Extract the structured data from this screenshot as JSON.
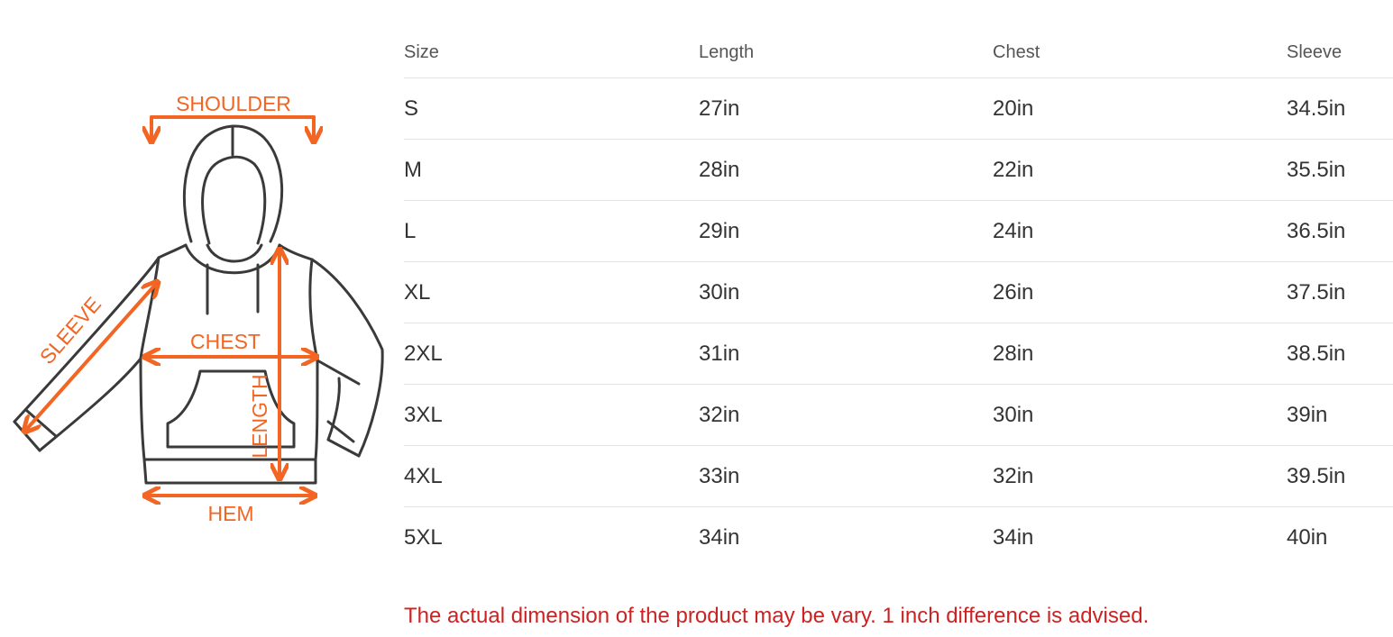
{
  "diagram": {
    "labels": {
      "shoulder": "SHOULDER",
      "sleeve": "SLEEVE",
      "chest": "CHEST",
      "length": "LENGTH",
      "hem": "HEM"
    },
    "accent_color": "#f26522",
    "outline_color": "#3a3a3a"
  },
  "table": {
    "headers": [
      "Size",
      "Length",
      "Chest",
      "Sleeve"
    ],
    "rows": [
      [
        "S",
        "27in",
        "20in",
        "34.5in"
      ],
      [
        "M",
        "28in",
        "22in",
        "35.5in"
      ],
      [
        "L",
        "29in",
        "24in",
        "36.5in"
      ],
      [
        "XL",
        "30in",
        "26in",
        "37.5in"
      ],
      [
        "2XL",
        "31in",
        "28in",
        "38.5in"
      ],
      [
        "3XL",
        "32in",
        "30in",
        "39in"
      ],
      [
        "4XL",
        "33in",
        "32in",
        "39.5in"
      ],
      [
        "5XL",
        "34in",
        "34in",
        "40in"
      ]
    ]
  },
  "note": "The actual dimension of the product may be vary. 1 inch difference is advised.",
  "note_color": "#cc2222"
}
